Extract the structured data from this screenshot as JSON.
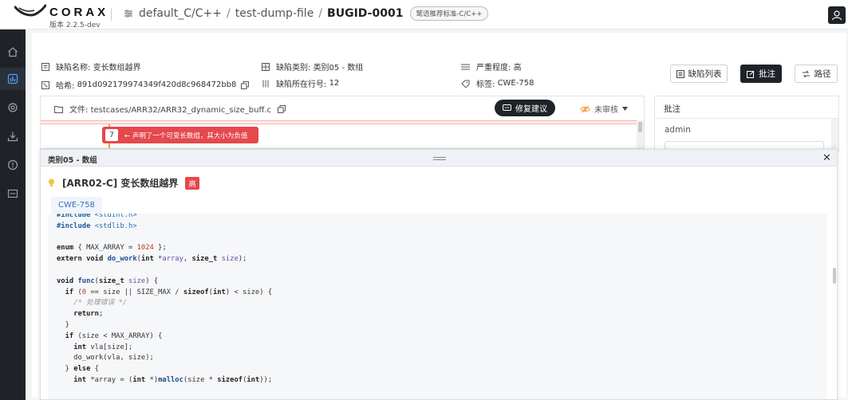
{
  "header": {
    "logo_text": "CORAX",
    "version": "版本 2.2.5-dev",
    "breadcrumbs": [
      "default_C/C++",
      "test-dump-file",
      "BUGID-0001"
    ],
    "standard_tag": "鹫语推荐标准-C/C++"
  },
  "defect": {
    "name_label": "缺陷名称:",
    "name_value": "变长数组越界",
    "hash_label": "哈希:",
    "hash_value": "891d092179974349f420d8c968472bb8",
    "category_label": "缺陷类别:",
    "category_value": "类别05 - 数组",
    "line_label": "缺陷所在行号:",
    "line_value": "12",
    "severity_label": "严重程度:",
    "severity_value": "高",
    "tag_label": "标签:",
    "tag_value": "CWE-758"
  },
  "toolbar": {
    "defect_list": "缺陷列表",
    "annotate": "批注",
    "path": "路径"
  },
  "code_view": {
    "file_label": "文件:",
    "file_path": "testcases/ARR32/ARR32_dynamic_size_buff.c",
    "fix_suggestion": "修复建议",
    "review_status": "未审核",
    "trace_step": "7",
    "trace_message": "← 声明了一个可变长数组，其大小为负值"
  },
  "annotation_panel": {
    "title": "批注",
    "user": "admin"
  },
  "rule_drawer": {
    "category": "类别05 - 数组",
    "rule_id": "[ARR02-C] 变长数组越界",
    "severity": "高",
    "cwe": "CWE-758"
  },
  "colors": {
    "dark": "#1f2329",
    "danger": "#e5484d",
    "warning": "#f5a623",
    "link": "#3a6fc4"
  }
}
